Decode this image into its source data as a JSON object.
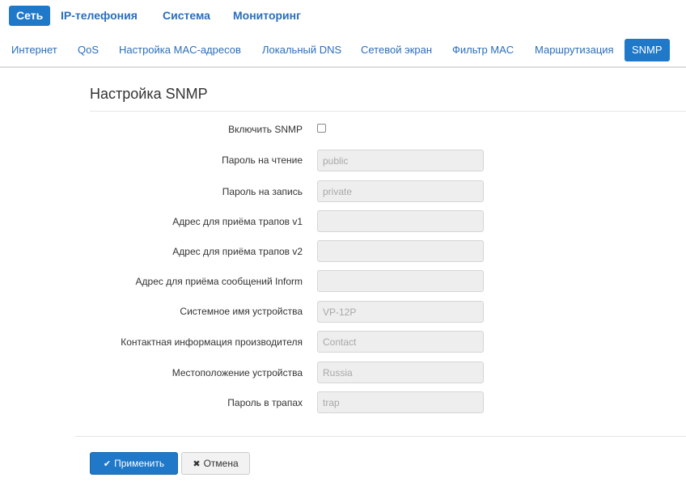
{
  "top_nav": {
    "tabs": [
      {
        "label": "Сеть",
        "active": true
      },
      {
        "label": "IP-телефония",
        "active": false
      },
      {
        "label": "Система",
        "active": false
      },
      {
        "label": "Мониторинг",
        "active": false
      }
    ]
  },
  "sub_nav": {
    "tabs": [
      {
        "label": "Интернет",
        "active": false
      },
      {
        "label": "QoS",
        "active": false
      },
      {
        "label": "Настройка MAC-адресов",
        "active": false
      },
      {
        "label": "Локальный DNS",
        "active": false
      },
      {
        "label": "Сетевой экран",
        "active": false
      },
      {
        "label": "Фильтр MAC",
        "active": false
      },
      {
        "label": "Маршрутизация",
        "active": false
      },
      {
        "label": "SNMP",
        "active": true
      }
    ]
  },
  "form": {
    "title": "Настройка SNMP",
    "enable": {
      "label": "Включить SNMP",
      "checked": false
    },
    "fields": [
      {
        "label": "Пароль на чтение",
        "value": "",
        "placeholder": "public"
      },
      {
        "label": "Пароль на запись",
        "value": "",
        "placeholder": "private"
      },
      {
        "label": "Адрес для приёма трапов v1",
        "value": "",
        "placeholder": ""
      },
      {
        "label": "Адрес для приёма трапов v2",
        "value": "",
        "placeholder": ""
      },
      {
        "label": "Адрес для приёма сообщений Inform",
        "value": "",
        "placeholder": ""
      },
      {
        "label": "Системное имя устройства",
        "value": "",
        "placeholder": "VP-12P"
      },
      {
        "label": "Контактная информация производителя",
        "value": "",
        "placeholder": "Contact"
      },
      {
        "label": "Местоположение устройства",
        "value": "",
        "placeholder": "Russia"
      },
      {
        "label": "Пароль в трапах",
        "value": "",
        "placeholder": "trap"
      }
    ]
  },
  "actions": {
    "apply_label": "Применить",
    "apply_icon": "check-icon",
    "cancel_label": "Отмена",
    "cancel_icon": "close-icon"
  },
  "colors": {
    "accent": "#1f78c8",
    "link": "#2a6ebb",
    "field_bg": "#eeeeee"
  }
}
